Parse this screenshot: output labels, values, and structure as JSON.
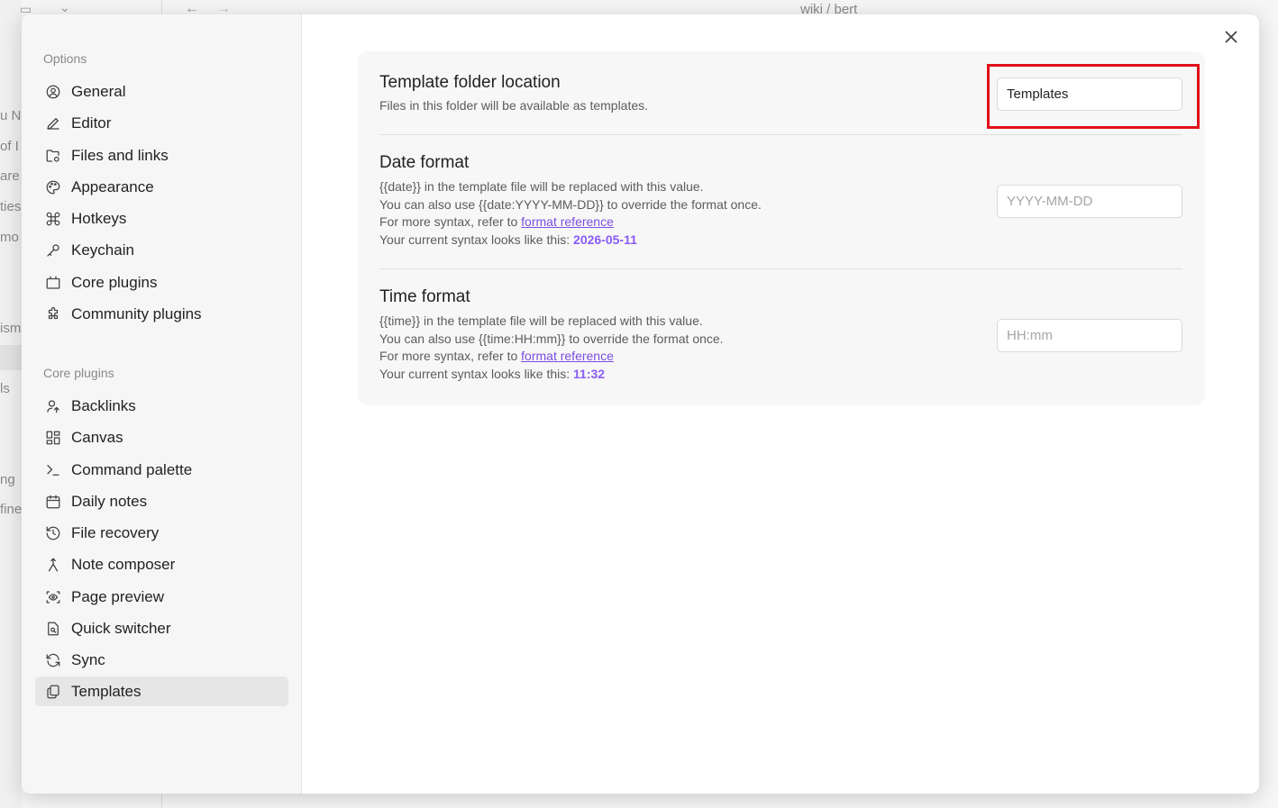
{
  "background_app": {
    "breadcrumb": "wiki / bert",
    "fragments": [
      "u N",
      "of I",
      "are",
      "ties",
      "mo",
      "ism",
      "ls",
      "ng",
      "fine"
    ]
  },
  "modal": {
    "sidebar": {
      "options_header": "Options",
      "options_items": [
        {
          "label": "General",
          "icon": "user-circle-icon"
        },
        {
          "label": "Editor",
          "icon": "pencil-icon"
        },
        {
          "label": "Files and links",
          "icon": "folder-cog-icon"
        },
        {
          "label": "Appearance",
          "icon": "palette-icon"
        },
        {
          "label": "Hotkeys",
          "icon": "command-icon"
        },
        {
          "label": "Keychain",
          "icon": "key-icon"
        },
        {
          "label": "Core plugins",
          "icon": "plugin-box-icon"
        },
        {
          "label": "Community plugins",
          "icon": "puzzle-icon"
        }
      ],
      "core_plugins_header": "Core plugins",
      "core_plugin_items": [
        {
          "label": "Backlinks",
          "icon": "link-user-icon"
        },
        {
          "label": "Canvas",
          "icon": "layout-dashboard-icon"
        },
        {
          "label": "Command palette",
          "icon": "terminal-icon"
        },
        {
          "label": "Daily notes",
          "icon": "calendar-icon"
        },
        {
          "label": "File recovery",
          "icon": "history-icon"
        },
        {
          "label": "Note composer",
          "icon": "merge-icon"
        },
        {
          "label": "Page preview",
          "icon": "scan-eye-icon"
        },
        {
          "label": "Quick switcher",
          "icon": "file-search-icon"
        },
        {
          "label": "Sync",
          "icon": "refresh-icon"
        },
        {
          "label": "Templates",
          "icon": "copy-icon",
          "active": true
        }
      ]
    },
    "settings": {
      "template_folder": {
        "name": "Template folder location",
        "desc": "Files in this folder will be available as templates.",
        "value": "Templates"
      },
      "date_format": {
        "name": "Date format",
        "line1": "{{date}} in the template file will be replaced with this value.",
        "line2": "You can also use {{date:YYYY-MM-DD}} to override the format once.",
        "line3_prefix": "For more syntax, refer to ",
        "link": "format reference",
        "line4_prefix": "Your current syntax looks like this: ",
        "sample": "2026-05-11",
        "placeholder": "YYYY-MM-DD"
      },
      "time_format": {
        "name": "Time format",
        "line1": "{{time}} in the template file will be replaced with this value.",
        "line2": "You can also use {{time:HH:mm}} to override the format once.",
        "line3_prefix": "For more syntax, refer to ",
        "link": "format reference",
        "line4_prefix": "Your current syntax looks like this: ",
        "sample": "11:32",
        "placeholder": "HH:mm"
      }
    },
    "highlight_color": "#e0101a",
    "accent_color": "#8a5cf5"
  }
}
